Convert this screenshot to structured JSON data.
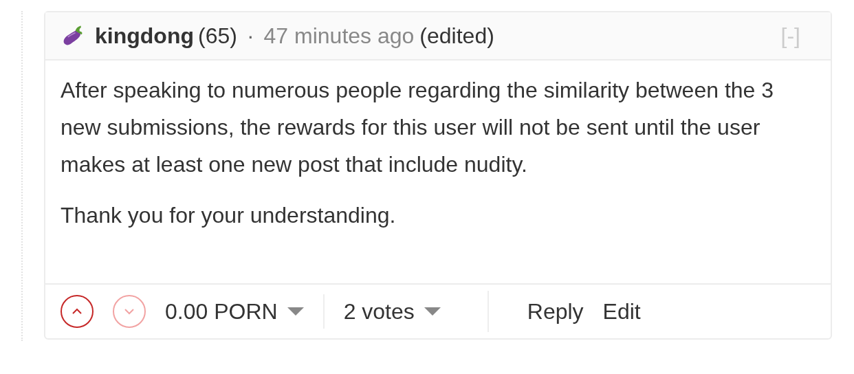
{
  "comment": {
    "author": "kingdong",
    "reputation": "(65)",
    "separator": "·",
    "time": "47 minutes ago",
    "edited": "(edited)",
    "collapse": "[-]",
    "paragraphs": [
      "After speaking to numerous people regarding the similarity between the 3 new submissions, the rewards for this user will not be sent until the user makes at least one new post that include nudity.",
      "Thank you for your understanding."
    ],
    "footer": {
      "upvote": {
        "disabled": false
      },
      "downvote": {
        "disabled": true
      },
      "payout": "0.00 PORN",
      "votes": "2 votes",
      "actions": [
        "Reply",
        "Edit"
      ]
    }
  }
}
